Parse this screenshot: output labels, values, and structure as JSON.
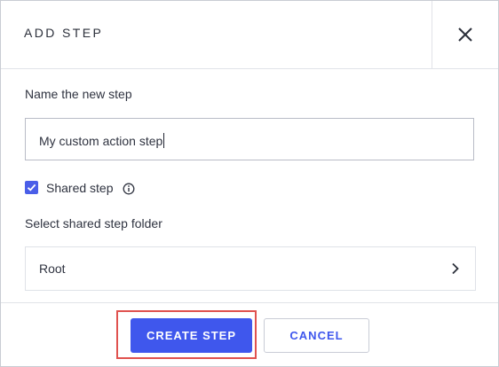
{
  "dialog": {
    "title": "ADD STEP",
    "close_icon": "close-icon"
  },
  "form": {
    "name_label": "Name the new step",
    "name_value": "My custom action step",
    "shared_checked": true,
    "shared_label": "Shared step",
    "info_icon": "info-icon",
    "folder_label": "Select shared step folder",
    "folder_value": "Root",
    "folder_chevron_icon": "chevron-right-icon"
  },
  "footer": {
    "create_label": "CREATE STEP",
    "cancel_label": "CANCEL"
  },
  "colors": {
    "accent": "#3f57ed",
    "checkbox": "#4a5ee8",
    "highlight": "#e0524f"
  }
}
